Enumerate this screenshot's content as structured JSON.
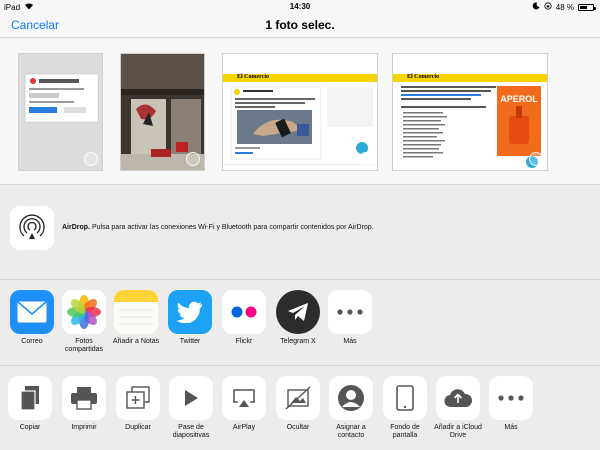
{
  "status": {
    "device": "iPad",
    "time": "14:30",
    "battery": "48 %"
  },
  "nav": {
    "cancel": "Cancelar",
    "title": "1 foto selec."
  },
  "airdrop": {
    "label": "AirDrop.",
    "text": "Pulsa para activar las conexiones Wi-Fi y Bluetooth para compartir contenidos por AirDrop."
  },
  "thumbnails": {
    "site_name": "El Comercio",
    "drink_brand": "APEROL"
  },
  "apps": [
    {
      "label": "Correo"
    },
    {
      "label": "Fotos compartidas"
    },
    {
      "label": "Añadir a Notas"
    },
    {
      "label": "Twitter"
    },
    {
      "label": "Flickr"
    },
    {
      "label": "Telegram X"
    },
    {
      "label": "Más"
    }
  ],
  "actions": [
    {
      "label": "Copiar"
    },
    {
      "label": "Imprimir"
    },
    {
      "label": "Duplicar"
    },
    {
      "label": "Pase de diapositivas"
    },
    {
      "label": "AirPlay"
    },
    {
      "label": "Ocultar"
    },
    {
      "label": "Asignar a contacto"
    },
    {
      "label": "Fondo de pantalla"
    },
    {
      "label": "Añadir a iCloud Drive"
    },
    {
      "label": "Más"
    }
  ],
  "colors": {
    "accent": "#0a7aff",
    "mail": "#1e8ef9",
    "twitter": "#1da1f2",
    "flickr_blue": "#0063dc",
    "flickr_pink": "#ff0084",
    "telegram": "#2c2c2c",
    "notes": "#ffd43b",
    "site_yellow": "#f5d400",
    "aperol": "#f26b1d"
  }
}
